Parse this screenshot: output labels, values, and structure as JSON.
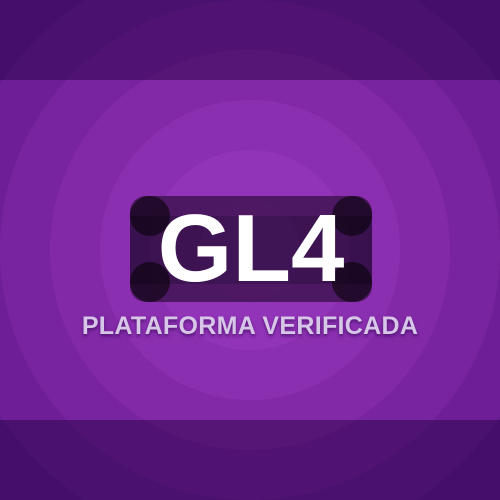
{
  "logo": {
    "text": "GL4"
  },
  "subtitle": {
    "text": "PLATAFORMA VERIFICADA"
  },
  "colors": {
    "background": "#7a26a3",
    "logo_text": "#ffffff",
    "subtitle_text": "#d8c6e8"
  }
}
